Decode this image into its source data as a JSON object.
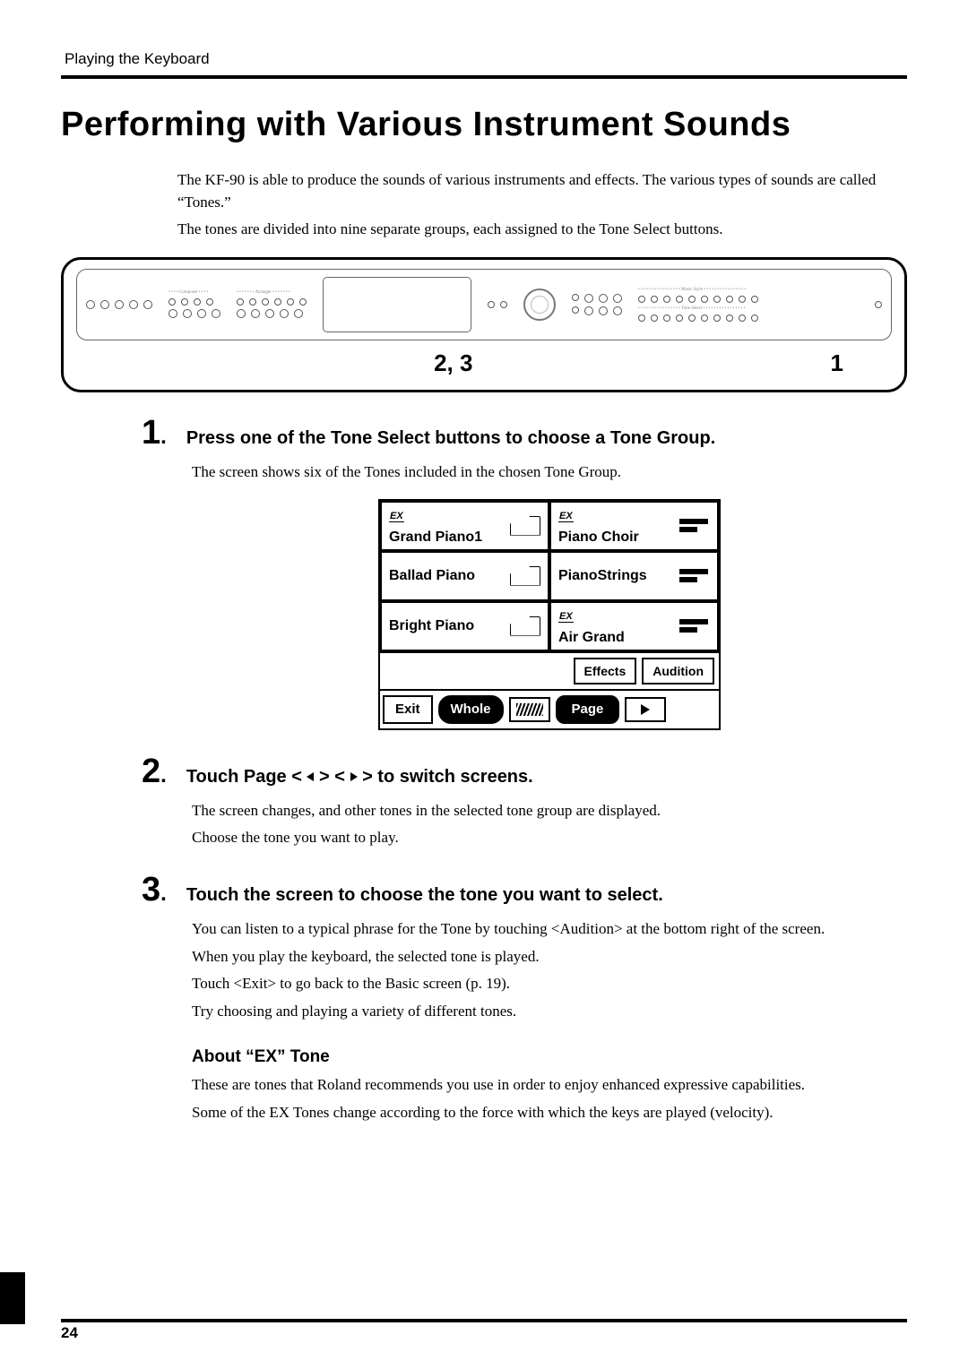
{
  "running_head": "Playing the Keyboard",
  "title": "Performing with Various Instrument Sounds",
  "intro": {
    "p1": "The KF-90 is able to produce the sounds of various instruments and effects. The various types of sounds are called “Tones.”",
    "p2": "The tones are divided into nine separate groups, each assigned to the Tone Select buttons."
  },
  "panel_refs": {
    "left": "2, 3",
    "right": "1"
  },
  "steps": [
    {
      "num": "1",
      "title": "Press one of the Tone Select buttons to choose a Tone Group.",
      "body": [
        "The screen shows six of the Tones included in the chosen Tone Group."
      ]
    },
    {
      "num": "2",
      "title_parts": {
        "a": "Touch Page < ",
        "b": " > < ",
        "c": " > to switch screens."
      },
      "body": [
        "The screen changes, and other tones in the selected tone group are displayed.",
        "Choose the tone you want to play."
      ]
    },
    {
      "num": "3",
      "title": "Touch the screen to choose the tone you want to select.",
      "body": [
        "You can listen to a typical phrase for the Tone by touching <Audition> at the bottom right of the screen.",
        "When you play the keyboard, the selected tone is played.",
        "Touch <Exit> to go back to the Basic screen (p. 19).",
        "Try choosing and playing a variety of different tones."
      ]
    }
  ],
  "lcd": {
    "cells": [
      {
        "ex": true,
        "label": "Grand Piano1",
        "icon": "piano"
      },
      {
        "ex": true,
        "label": "Piano Choir",
        "icon": "bars"
      },
      {
        "ex": false,
        "label": "Ballad Piano",
        "icon": "piano"
      },
      {
        "ex": false,
        "label": "PianoStrings",
        "icon": "bars"
      },
      {
        "ex": false,
        "label": "Bright Piano",
        "icon": "piano"
      },
      {
        "ex": true,
        "label": "Air Grand",
        "icon": "bars"
      }
    ],
    "row_btns": {
      "effects": "Effects",
      "audition": "Audition"
    },
    "footer": {
      "exit": "Exit",
      "whole": "Whole",
      "page": "Page"
    }
  },
  "subhead": "About “EX” Tone",
  "sub_body": {
    "p1": "These are tones that Roland recommends you use in order to enjoy enhanced expressive capabilities.",
    "p2": "Some of the EX Tones change according to the force with which the keys are played (velocity)."
  },
  "page_number": "24",
  "ex_tag": "EX"
}
